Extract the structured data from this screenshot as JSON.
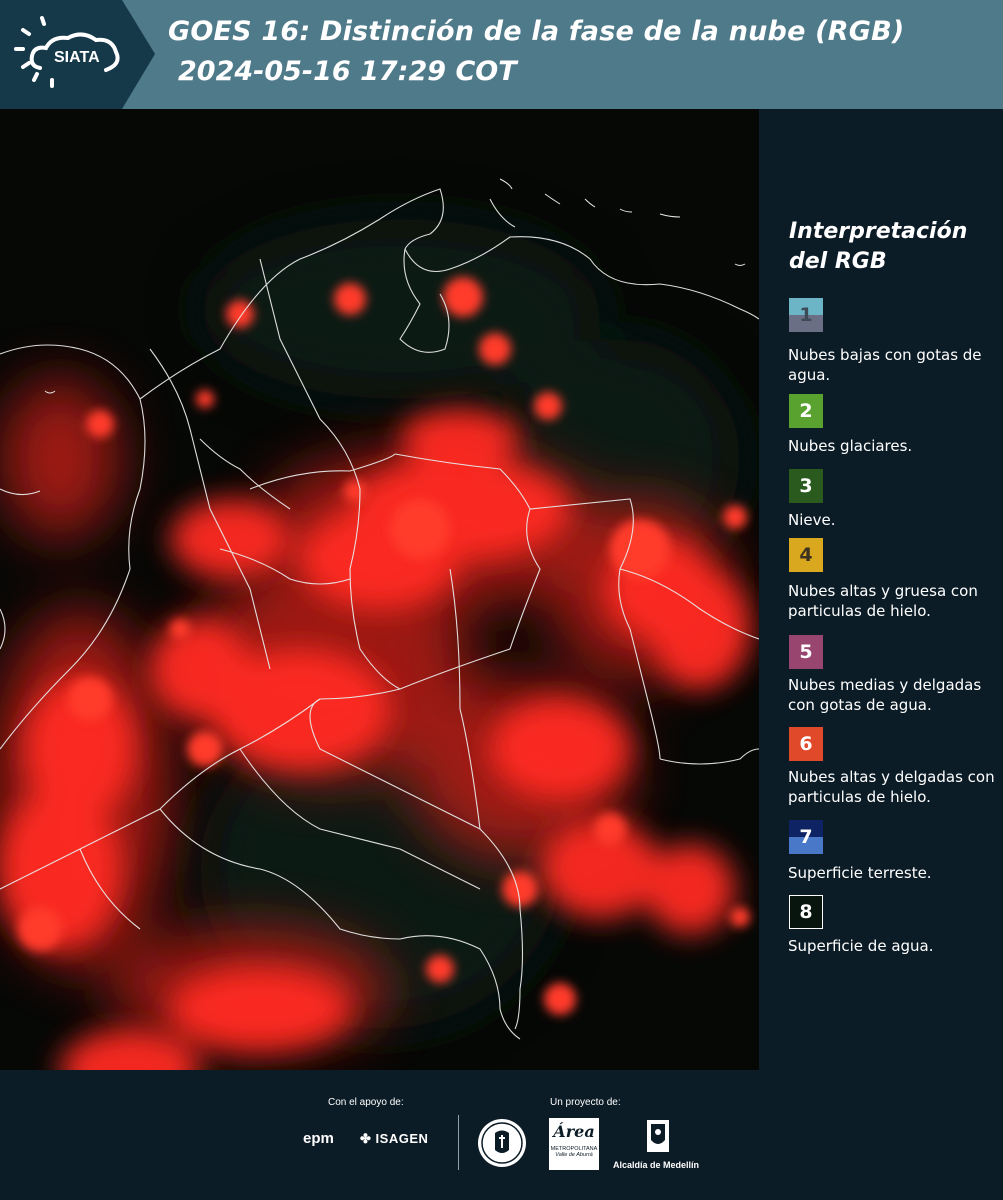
{
  "header": {
    "logo_text": "SIATA",
    "title_line1": "GOES 16: Distinción de la fase de la nube (RGB)",
    "title_line2": "2024-05-16 17:29 COT"
  },
  "legend": {
    "title": "Interpretación del RGB",
    "items": [
      {
        "number": "1",
        "label": "Nubes bajas con gotas de agua.",
        "color_top": "#6bb5c6",
        "color_bottom": "#6a6f86"
      },
      {
        "number": "2",
        "label": "Nubes glaciares.",
        "color_top": "#5aa22f"
      },
      {
        "number": "3",
        "label": "Nieve.",
        "color_top": "#2a5a1d"
      },
      {
        "number": "4",
        "label": "Nubes altas y gruesa con particulas de hielo.",
        "color_top": "#d9a81e"
      },
      {
        "number": "5",
        "label": "Nubes medias y delgadas con gotas de agua.",
        "color_top": "#98456f"
      },
      {
        "number": "6",
        "label": "Nubes altas y delgadas con particulas de hielo.",
        "color_top": "#e04a2a"
      },
      {
        "number": "7",
        "label": "Superficie terreste.",
        "color_top": "#0e2364",
        "color_bottom": "#4a78c8"
      },
      {
        "number": "8",
        "label": "Superficie de agua.",
        "color_top": "#08140e",
        "border": "#ffffff"
      }
    ]
  },
  "footer": {
    "support_label": "Con el apoyo de:",
    "project_label": "Un proyecto de:",
    "epm_logo": "epm",
    "isagen_logo": "ISAGEN",
    "area_logo": "Área",
    "area_sub1": "METROPOLITANA",
    "area_sub2": "Valle de Aburrá",
    "alcaldia_label": "Alcaldía de Medellín"
  },
  "icons": [
    "siata-sun-cloud-icon",
    "epm-logo-icon",
    "isagen-logo-icon",
    "university-seal-icon",
    "area-metropolitana-logo-icon",
    "alcaldia-shield-icon"
  ]
}
